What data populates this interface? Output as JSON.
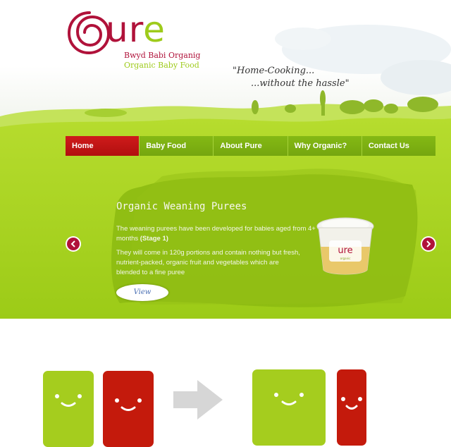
{
  "logo": {
    "word_o": "O",
    "word_rest_u": "u",
    "word_rest_r": "r",
    "word_rest_e": "e",
    "subtitle_welsh": "Bwyd Babi Organig",
    "subtitle_english": "Organic Baby Food"
  },
  "tagline": {
    "line1": "\"Home-Cooking...",
    "line2": "...without the hassle\""
  },
  "nav": {
    "items": [
      {
        "label": "Home",
        "active": true
      },
      {
        "label": "Baby Food",
        "active": false
      },
      {
        "label": "About Pure",
        "active": false
      },
      {
        "label": "Why Organic?",
        "active": false
      },
      {
        "label": "Contact Us",
        "active": false
      }
    ]
  },
  "slide": {
    "title": "Organic Weaning Purees",
    "para1_text": "The weaning purees have been developed for babies aged from 4+ months ",
    "para1_bold": "(Stage 1)",
    "para2": "They will come in 120g portions and contain nothing but fresh, nutrient-packed, organic fruit and vegetables which are blended to a fine puree",
    "view_label": "View",
    "prev_icon": "chevron-left-icon",
    "next_icon": "chevron-right-icon"
  },
  "colors": {
    "green": "#a5cd1e",
    "red": "#c41a0c",
    "logo_red": "#b0123a",
    "arrow_gray": "#d6d6d6"
  },
  "diagram": {
    "before": [
      "green-face-card",
      "red-face-card"
    ],
    "transition_icon": "arrow-right-icon",
    "after": [
      "green-face-card-wide",
      "red-face-card-narrow"
    ]
  }
}
